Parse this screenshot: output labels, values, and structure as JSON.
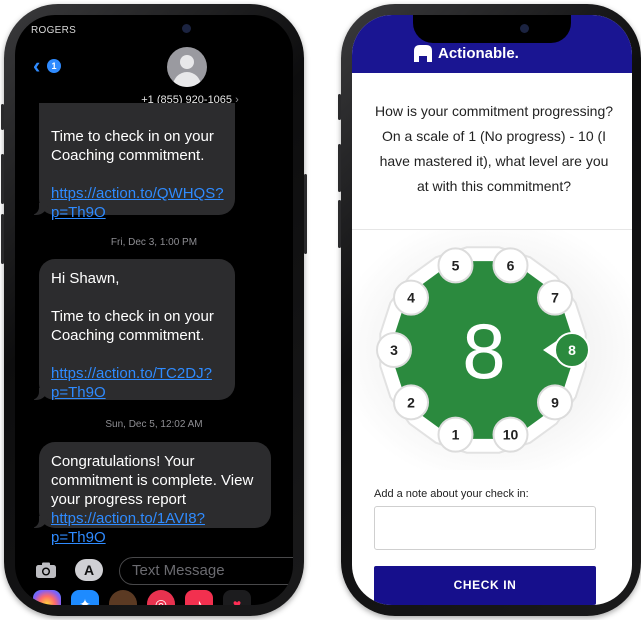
{
  "messages_app": {
    "carrier": "ROGERS LT",
    "back_badge": "1",
    "contact_number": "+1 (855) 920-1065",
    "chevron": "›",
    "bubble_1": {
      "line": "Time to check in on your Coaching commitment.",
      "link": "https://action.to/QWHQS?p=Th9O"
    },
    "timestamp_1": "Fri, Dec 3, 1:00 PM",
    "bubble_2": {
      "greeting": "Hi Shawn,",
      "line": "Time to check in on your Coaching commitment.",
      "link": "https://action.to/TC2DJ?p=Th9O"
    },
    "timestamp_2": "Sun, Dec 5, 12:02 AM",
    "bubble_3": {
      "line": "Congratulations! Your commitment is complete. View your progress report",
      "link": "https://action.to/1AVI8?p=Th9O"
    },
    "input_placeholder": "Text Message",
    "apps_button": "A",
    "tray_icons": [
      "photos-icon",
      "app-store-icon",
      "memoji-icon",
      "web-search-icon",
      "music-icon",
      "heart-icon"
    ]
  },
  "actionable_app": {
    "brand": "Actionable.",
    "question": "How is your commitment progressing? On a scale of 1 (No progress) - 10 (I have mastered it), what level are you at with this commitment?",
    "selected_value": "8",
    "scale": [
      "1",
      "2",
      "3",
      "4",
      "5",
      "6",
      "7",
      "8",
      "9",
      "10"
    ],
    "note_label": "Add a note about your check in:",
    "note_value": "",
    "checkin_button": "CHECK IN",
    "colors": {
      "header": "#1a1592",
      "dial_green": "#2b8a3e",
      "button": "#160f8c"
    }
  }
}
